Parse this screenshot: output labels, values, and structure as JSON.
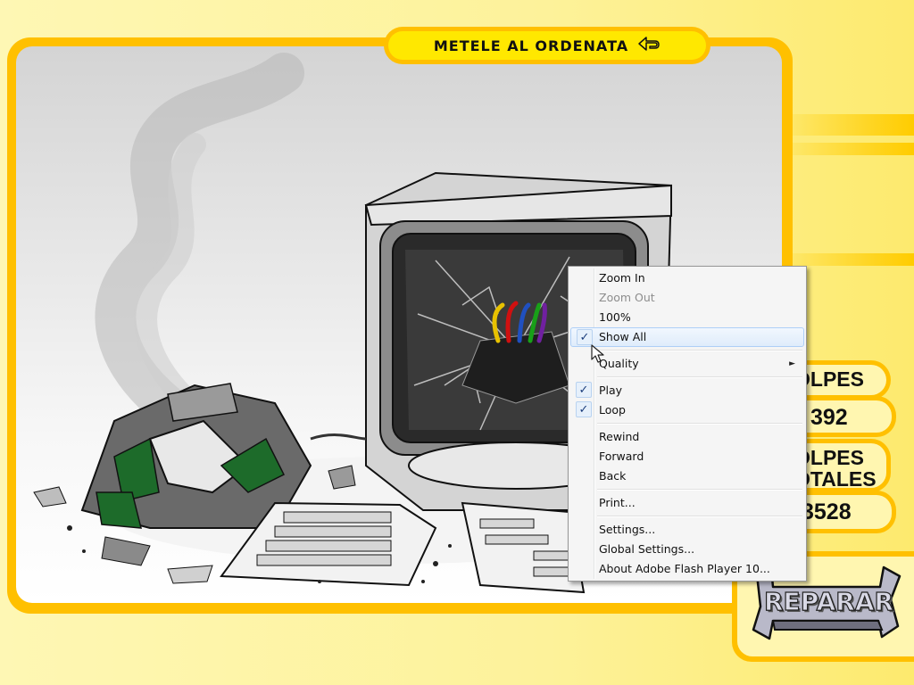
{
  "game": {
    "title": "METELE AL ORDENATA",
    "back_icon": "back-arrow-icon"
  },
  "scores": {
    "hits_label": "OLPES",
    "hits_value": "392",
    "total_label_1": "OLPES",
    "total_label_2": "OTALES",
    "total_value": "3528"
  },
  "repair_button": {
    "label": "REPARAR"
  },
  "context_menu": {
    "zoom_in": "Zoom In",
    "zoom_out": "Zoom Out",
    "zoom_100": "100%",
    "show_all": "Show All",
    "quality": "Quality",
    "play": "Play",
    "loop": "Loop",
    "rewind": "Rewind",
    "forward": "Forward",
    "back": "Back",
    "print": "Print...",
    "settings": "Settings...",
    "global_settings": "Global Settings...",
    "about": "About Adobe Flash Player 10...",
    "check_glyph": "✓",
    "submenu_glyph": "►"
  },
  "colors": {
    "frame": "#ffc000",
    "title_fill": "#ffe800",
    "panel_fill": "#fff6b0",
    "menu_highlight": "#dfecfb"
  }
}
